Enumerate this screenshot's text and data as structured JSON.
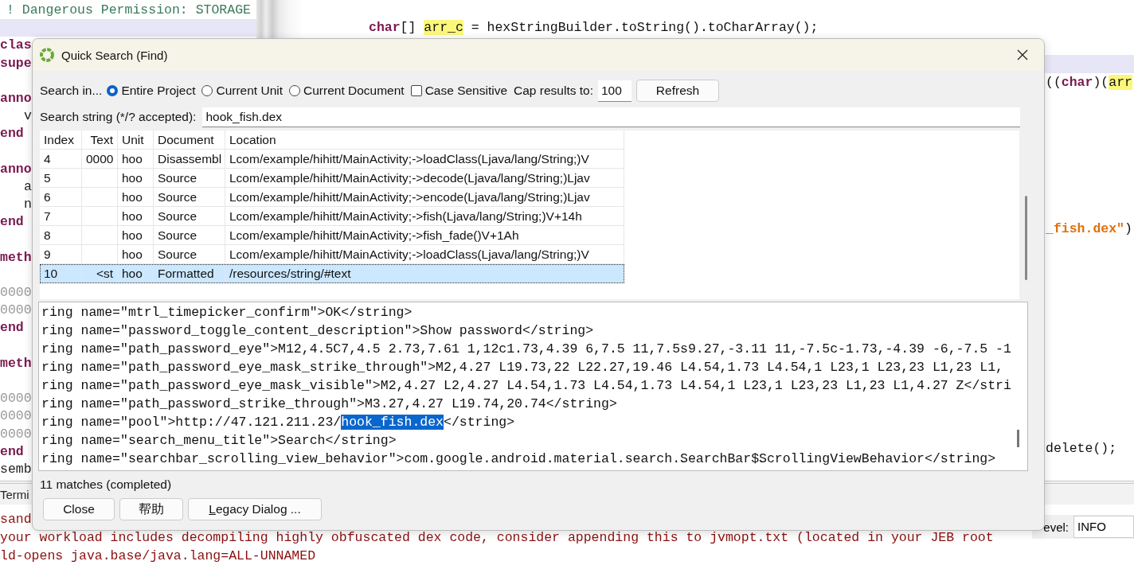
{
  "permissions_pane": {
    "lines": [
      {
        "text": "! Dangerous Permission: STORAGE",
        "kind": "comment",
        "current": false
      },
      {
        "current": true
      },
      {
        "text": "clas",
        "kind": "keyword",
        "current": false
      },
      {
        "text": "supe",
        "kind": "keyword",
        "current": false
      },
      {
        "current": false
      },
      {
        "text": "anno",
        "kind": "keyword",
        "current": false
      },
      {
        "text": "v",
        "kind": "indented",
        "current": false
      },
      {
        "text": "end",
        "kind": "keyword",
        "current": false
      },
      {
        "current": false
      },
      {
        "text": "anno",
        "kind": "keyword",
        "current": false
      },
      {
        "text": "a",
        "kind": "indented",
        "current": false
      },
      {
        "text": "n",
        "kind": "indented",
        "current": false
      },
      {
        "text": "end",
        "kind": "keyword",
        "current": false
      },
      {
        "current": false
      },
      {
        "text": "meth",
        "kind": "keyword",
        "current": false
      },
      {
        "current": false
      },
      {
        "text": "0000",
        "kind": "address",
        "current": false
      },
      {
        "text": "0000",
        "kind": "address",
        "current": false
      },
      {
        "text": "end",
        "kind": "keyword",
        "current": false
      },
      {
        "current": false
      },
      {
        "text": "meth",
        "kind": "keyword",
        "current": false
      },
      {
        "current": false
      },
      {
        "text": "0000",
        "kind": "address",
        "current": false
      },
      {
        "text": "0000",
        "kind": "address",
        "current": false
      },
      {
        "text": "0000",
        "kind": "address",
        "current": false
      },
      {
        "text": "end",
        "kind": "keyword",
        "current": false
      },
      {
        "text": "semb",
        "kind": "plain",
        "current": false
      }
    ]
  },
  "editor": {
    "lines": [
      {
        "kind": "code",
        "current": false,
        "segments": [
          {
            "text": "char",
            "kind": "keyword"
          },
          {
            "text": "[] ",
            "kind": "plain"
          },
          {
            "text": "arr_c",
            "kind": "highlight"
          },
          {
            "text": " = hexStringBuilder.toString().toCharArray();",
            "kind": "plain"
          }
        ]
      },
      {
        "kind": "code",
        "current": false
      },
      {
        "kind": "code",
        "current": true
      },
      {
        "kind": "edge",
        "current": false,
        "segments": [
          {
            "text": "((",
            "kind": "plain"
          },
          {
            "text": "char",
            "kind": "keyword"
          },
          {
            "text": ")(",
            "kind": "plain"
          },
          {
            "text": "arr",
            "kind": "highlight"
          }
        ]
      },
      {
        "kind": "code",
        "current": false
      },
      {
        "kind": "code",
        "current": false
      },
      {
        "kind": "code",
        "current": false
      },
      {
        "kind": "code",
        "current": false
      },
      {
        "kind": "code",
        "current": false
      },
      {
        "kind": "code",
        "current": false
      },
      {
        "kind": "code",
        "current": false
      },
      {
        "kind": "edge",
        "current": false,
        "segments": [
          {
            "text": "_fish.dex\"",
            "kind": "string"
          },
          {
            "text": ")",
            "kind": "plain"
          }
        ]
      },
      {
        "kind": "code",
        "current": false
      },
      {
        "kind": "code",
        "current": false
      },
      {
        "kind": "code",
        "current": false
      },
      {
        "kind": "code",
        "current": false
      },
      {
        "kind": "code",
        "current": false
      },
      {
        "kind": "code",
        "current": false
      },
      {
        "kind": "code",
        "current": false
      },
      {
        "kind": "code",
        "current": false
      },
      {
        "kind": "code",
        "current": false
      },
      {
        "kind": "code",
        "current": false
      },
      {
        "kind": "code",
        "current": false
      },
      {
        "kind": "edge",
        "current": false,
        "segments": [
          {
            "text": "delete();",
            "kind": "plain"
          }
        ]
      }
    ]
  },
  "console": {
    "tab": "Termi",
    "lines": [
      "sand",
      "your workload includes decompiling highly obfuscated dex code, consider appending this to jvmopt.txt (located in your JEB root",
      "ld-opens java.base/java.lang=ALL-UNNAMED"
    ],
    "log_level_label": "evel:",
    "log_level_value": "INFO"
  },
  "dialog": {
    "title": "Quick Search (Find)",
    "search_in_label": "Search in...",
    "search_in": [
      {
        "label": "Entire Project",
        "selected": true
      },
      {
        "label": "Current Unit",
        "selected": false
      },
      {
        "label": "Current Document",
        "selected": false
      }
    ],
    "case_sensitive": {
      "label": "Case Sensitive",
      "checked": false
    },
    "cap_label": "Cap results to:",
    "cap_value": "100",
    "refresh": "Refresh",
    "search_label": "Search string (*/? accepted):",
    "search_value": "hook_fish.dex",
    "table": {
      "columns": [
        "Index",
        "Text",
        "Unit",
        "Document",
        "Location"
      ],
      "rows": [
        {
          "index": "4",
          "text": "0000",
          "unit": "hoo",
          "document": "Disassembl",
          "location": "Lcom/example/hihitt/MainActivity;->loadClass(Ljava/lang/String;)V",
          "selected": false
        },
        {
          "index": "5",
          "unit": "hoo",
          "document": "Source",
          "location": "Lcom/example/hihitt/MainActivity;->decode(Ljava/lang/String;)Ljav",
          "selected": false
        },
        {
          "index": "6",
          "unit": "hoo",
          "document": "Source",
          "location": "Lcom/example/hihitt/MainActivity;->encode(Ljava/lang/String;)Ljav",
          "selected": false
        },
        {
          "index": "7",
          "unit": "hoo",
          "document": "Source",
          "location": "Lcom/example/hihitt/MainActivity;->fish(Ljava/lang/String;)V+14h",
          "selected": false
        },
        {
          "index": "8",
          "unit": "hoo",
          "document": "Source",
          "location": "Lcom/example/hihitt/MainActivity;->fish_fade()V+1Ah",
          "selected": false
        },
        {
          "index": "9",
          "unit": "hoo",
          "document": "Source",
          "location": "Lcom/example/hihitt/MainActivity;->loadClass(Ljava/lang/String;)V",
          "selected": false
        },
        {
          "index": "10",
          "text": "<st",
          "unit": "hoo",
          "document": "Formatted",
          "location": "/resources/string/#text",
          "selected": true
        }
      ]
    },
    "preview": [
      {
        "segments": [
          {
            "text": "ring name=\"mtrl_timepicker_confirm\">OK</string>",
            "match": false
          }
        ]
      },
      {
        "segments": [
          {
            "text": "ring name=\"password_toggle_content_description\">Show password</string>",
            "match": false
          }
        ]
      },
      {
        "segments": [
          {
            "text": "ring name=\"path_password_eye\">M12,4.5C7,4.5 2.73,7.61 1,12c1.73,4.39 6,7.5 11,7.5s9.27,-3.11 11,-7.5c-1.73,-4.39 -6,-7.5 -1",
            "match": false
          }
        ]
      },
      {
        "segments": [
          {
            "text": "ring name=\"path_password_eye_mask_strike_through\">M2,4.27 L19.73,22 L22.27,19.46 L4.54,1.73 L4.54,1 L23,1 L23,23 L1,23 L1,",
            "match": false
          }
        ]
      },
      {
        "segments": [
          {
            "text": "ring name=\"path_password_eye_mask_visible\">M2,4.27 L2,4.27 L4.54,1.73 L4.54,1.73 L4.54,1 L23,1 L23,23 L1,23 L1,4.27 Z</stri",
            "match": false
          }
        ]
      },
      {
        "segments": [
          {
            "text": "ring name=\"path_password_strike_through\">M3.27,4.27 L19.74,20.74</string>",
            "match": false
          }
        ]
      },
      {
        "segments": [
          {
            "text": "ring name=\"pool\">http://47.121.211.23/",
            "match": false
          },
          {
            "text": "hook_fish.dex",
            "match": true
          },
          {
            "text": "</string>",
            "match": false
          }
        ]
      },
      {
        "segments": [
          {
            "text": "ring name=\"search_menu_title\">Search</string>",
            "match": false
          }
        ]
      },
      {
        "segments": [
          {
            "text": "ring name=\"searchbar_scrolling_view_behavior\">com.google.android.material.search.SearchBar$ScrollingViewBehavior</string>",
            "match": false
          }
        ]
      }
    ],
    "status": "11 matches (completed)",
    "buttons": [
      "Close",
      "帮助",
      "Legacy Dialog ..."
    ]
  }
}
